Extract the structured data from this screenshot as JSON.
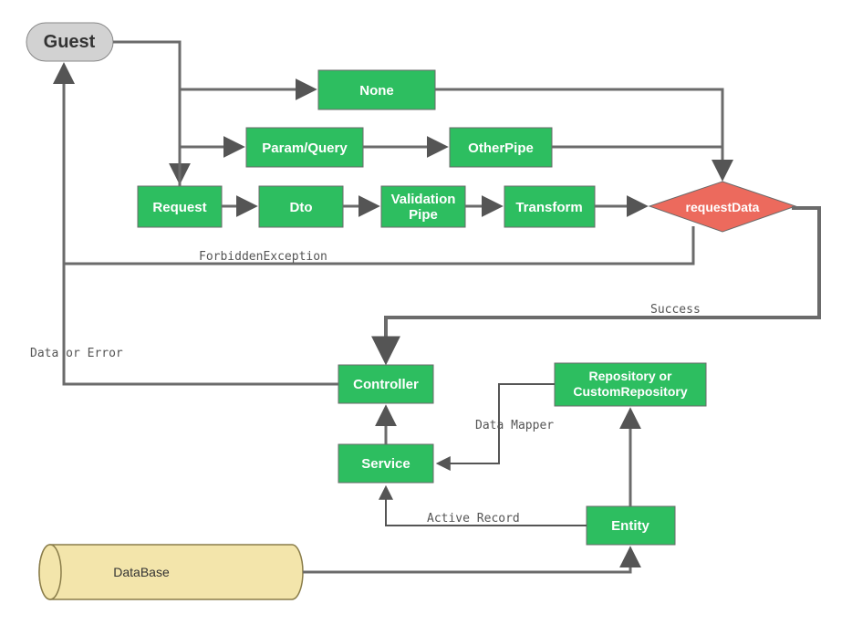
{
  "nodes": {
    "guest": "Guest",
    "request": "Request",
    "none": "None",
    "paramQuery": "Param/Query",
    "otherPipe": "OtherPipe",
    "dto": "Dto",
    "validationPipe": "Validation\nPipe",
    "transform": "Transform",
    "requestData": "requestData",
    "controller": "Controller",
    "service": "Service",
    "repository": "Repository or\nCustomRepository",
    "entity": "Entity",
    "database": "DataBase"
  },
  "edgeLabels": {
    "forbidden": "ForbiddenException",
    "success": "Success",
    "dataOrError": "Data or Error",
    "dataMapper": "Data Mapper",
    "activeRecord": "Active Record"
  }
}
